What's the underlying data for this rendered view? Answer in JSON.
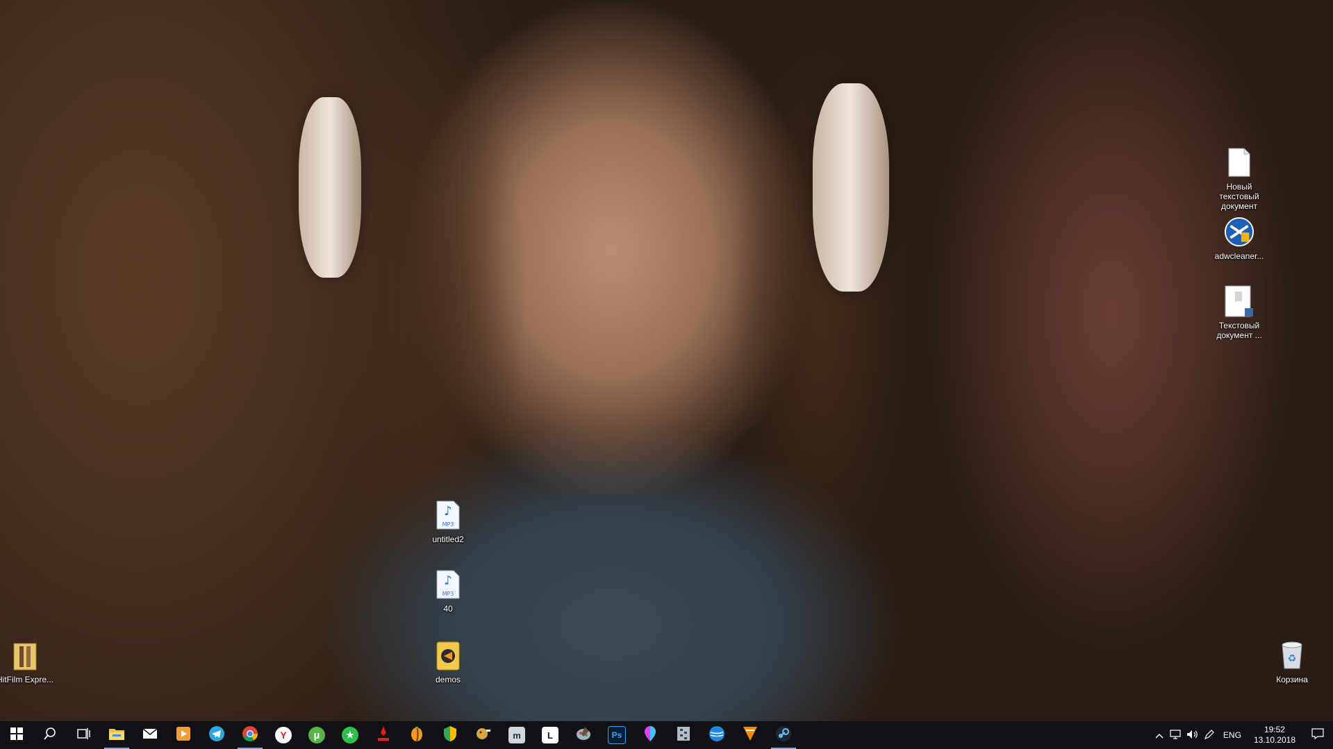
{
  "desktop": {
    "icons": [
      {
        "label": "Новый текстовый документ",
        "icon": "text-document-icon"
      },
      {
        "label": "adwcleaner...",
        "icon": "adwcleaner-icon"
      },
      {
        "label": "Текстовый документ ...",
        "icon": "text-document-icon"
      },
      {
        "label": "untitled2",
        "icon": "mp3-file-icon"
      },
      {
        "label": "40",
        "icon": "mp3-file-icon"
      },
      {
        "label": "demos",
        "icon": "folder-icon"
      },
      {
        "label": "HitFilm Expre...",
        "icon": "hitfilm-icon"
      },
      {
        "label": "Корзина",
        "icon": "recycle-bin-icon"
      }
    ]
  },
  "taskbar": {
    "apps": [
      {
        "name": "file-explorer",
        "label": "",
        "color": "#f2c14e"
      },
      {
        "name": "mail",
        "label": "",
        "color": "#ffffff"
      },
      {
        "name": "media-player",
        "label": "",
        "color": "#f0a030"
      },
      {
        "name": "telegram",
        "label": "",
        "color": "#2ca5e0"
      },
      {
        "name": "chrome",
        "label": "",
        "color": "#db4437"
      },
      {
        "name": "yandex-browser",
        "label": "Y",
        "color": "#ffffff"
      },
      {
        "name": "utorrent",
        "label": "µ",
        "color": "#58b448"
      },
      {
        "name": "green-app",
        "label": "★",
        "color": "#2fbf4a"
      },
      {
        "name": "red-app",
        "label": "",
        "color": "#e02020"
      },
      {
        "name": "fl-studio",
        "label": "",
        "color": "#f39a1e"
      },
      {
        "name": "vpn-shield",
        "label": "",
        "color": "#34a853"
      },
      {
        "name": "game-app",
        "label": "",
        "color": "#d9a441"
      },
      {
        "name": "mo-app",
        "label": "m",
        "color": "#cfd8dc"
      },
      {
        "name": "lightroom",
        "label": "L",
        "color": "#ffffff"
      },
      {
        "name": "paint-app",
        "label": "",
        "color": "#9fb6c8"
      },
      {
        "name": "photoshop",
        "label": "Ps",
        "color": "#31a8ff"
      },
      {
        "name": "maps-app",
        "label": "",
        "color": "#e040fb"
      },
      {
        "name": "archive-app",
        "label": "",
        "color": "#b0bec5"
      },
      {
        "name": "browser-app",
        "label": "",
        "color": "#1e88e5"
      },
      {
        "name": "vlc-app",
        "label": "",
        "color": "#ff8800"
      },
      {
        "name": "steam",
        "label": "",
        "color": "#66c0f4"
      }
    ],
    "tray": {
      "language": "ENG",
      "time": "19:52",
      "date": "13.10.2018"
    }
  }
}
